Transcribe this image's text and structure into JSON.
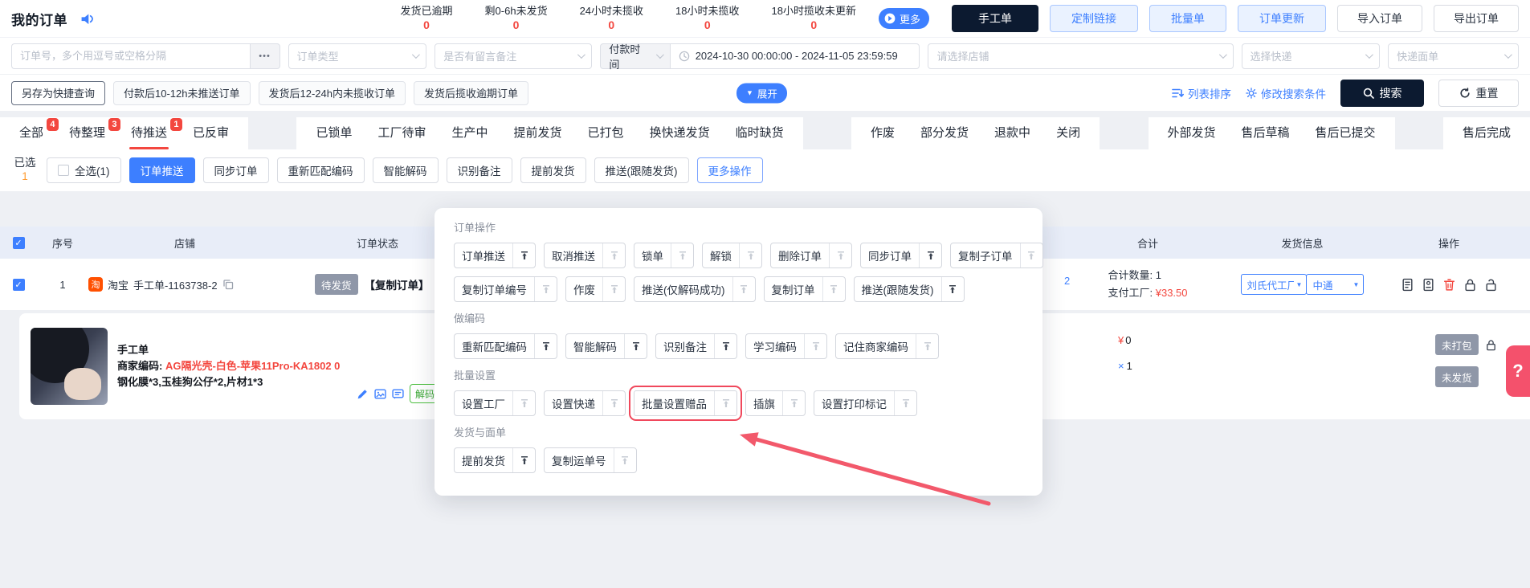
{
  "colors": {
    "primary": "#3d7fff",
    "danger": "#f3473f",
    "dark": "#0c1a30",
    "green": "#3aa834",
    "orange": "#ff9a2e"
  },
  "icons": {
    "check": "✓",
    "ellipsis": "•••",
    "caret_down": "▼",
    "select_caret": "▼",
    "question": "?"
  },
  "header": {
    "title": "我的订单",
    "stats": [
      {
        "label": "发货已逾期",
        "value": "0"
      },
      {
        "label": "剩0-6h未发货",
        "value": "0"
      },
      {
        "label": "24小时未揽收",
        "value": "0"
      },
      {
        "label": "18小时未揽收",
        "value": "0"
      },
      {
        "label": "18小时揽收未更新",
        "value": "0"
      }
    ],
    "more_label": "更多",
    "buttons": {
      "manual": "手工单",
      "custom_link": "定制链接",
      "batch": "批量单",
      "order_update": "订单更新",
      "import": "导入订单",
      "export": "导出订单"
    }
  },
  "filters": {
    "order_no_placeholder": "订单号，多个用逗号或空格分隔",
    "order_type": "订单类型",
    "has_message": "是否有留言备注",
    "pay_time": "付款时间",
    "date_range": "2024-10-30 00:00:00  -  2024-11-05 23:59:59",
    "shop": "请选择店铺",
    "express": "选择快递",
    "waybill": "快递面单"
  },
  "quick": {
    "save": "另存为快捷查询",
    "items": [
      "付款后10-12h未推送订单",
      "发货后12-24h内未揽收订单",
      "发货后揽收逾期订单"
    ],
    "expand": "展开",
    "sort": "列表排序",
    "modify": "修改搜索条件",
    "search": "搜索",
    "reset": "重置"
  },
  "tabs": {
    "group1": [
      {
        "label": "全部",
        "badge": "4"
      },
      {
        "label": "待整理",
        "badge": "3"
      },
      {
        "label": "待推送",
        "badge": "1",
        "active": true
      },
      {
        "label": "已反审"
      }
    ],
    "group2": [
      {
        "label": "已锁单"
      },
      {
        "label": "工厂待审"
      },
      {
        "label": "生产中"
      },
      {
        "label": "提前发货"
      },
      {
        "label": "已打包"
      },
      {
        "label": "换快递发货"
      },
      {
        "label": "临时缺货"
      }
    ],
    "group3": [
      {
        "label": "作废"
      },
      {
        "label": "部分发货"
      },
      {
        "label": "退款中"
      },
      {
        "label": "关闭"
      }
    ],
    "group4": [
      {
        "label": "外部发货"
      },
      {
        "label": "售后草稿"
      },
      {
        "label": "售后已提交"
      }
    ],
    "group5": [
      {
        "label": "售后完成"
      }
    ]
  },
  "action_bar": {
    "selected_label": "已选",
    "selected_count": "1",
    "select_all": "全选(1)",
    "push": "订单推送",
    "buttons": [
      "同步订单",
      "重新匹配编码",
      "智能解码",
      "识别备注",
      "提前发货",
      "推送(跟随发货)"
    ],
    "more": "更多操作"
  },
  "table": {
    "headers": [
      "序号",
      "店铺",
      "订单状态",
      "合计",
      "发货信息",
      "操作"
    ],
    "row": {
      "index": "1",
      "platform_glyph": "淘",
      "platform_name": "淘宝",
      "order_no": "手工单-1163738-2",
      "status": "待发货",
      "tag": "【复制订单】",
      "covered_fragment": "2",
      "qty_line": "合计数量: 1",
      "pay_label": "支付工厂:",
      "pay_value": "¥33.50",
      "factory": "刘氏代工厂",
      "express": "中通"
    },
    "product": {
      "name": "手工单",
      "code_label": "商家编码:",
      "code_value": "AG隔光壳-白色-苹果11Pro-KA1802 0",
      "spec": "钢化膜*3,玉桂狗公仔*2,片材1*3",
      "decode_badge": "解码成功",
      "currency": "¥",
      "price": "0",
      "times": "×",
      "qty": "1",
      "badge_pack": "未打包",
      "badge_ship": "未发货"
    }
  },
  "dropdown": {
    "s1": "订单操作",
    "s2": "做编码",
    "s3": "批量设置",
    "s4": "发货与面单",
    "rows1a": [
      {
        "label": "订单推送",
        "pinned": true
      },
      {
        "label": "取消推送"
      },
      {
        "label": "锁单"
      },
      {
        "label": "解锁"
      },
      {
        "label": "删除订单"
      },
      {
        "label": "同步订单",
        "pinned": true
      },
      {
        "label": "复制子订单"
      }
    ],
    "rows1b": [
      {
        "label": "复制订单编号"
      },
      {
        "label": "作废"
      },
      {
        "label": "推送(仅解码成功)"
      },
      {
        "label": "复制订单"
      },
      {
        "label": "推送(跟随发货)",
        "pinned": true
      }
    ],
    "rows2": [
      {
        "label": "重新匹配编码",
        "pinned": true
      },
      {
        "label": "智能解码",
        "pinned": true
      },
      {
        "label": "识别备注",
        "pinned": true
      },
      {
        "label": "学习编码"
      },
      {
        "label": "记住商家编码"
      }
    ],
    "rows3": [
      {
        "label": "设置工厂"
      },
      {
        "label": "设置快递"
      },
      {
        "label": "批量设置赠品",
        "highlight": true
      },
      {
        "label": "插旗"
      },
      {
        "label": "设置打印标记"
      }
    ],
    "rows4": [
      {
        "label": "提前发货",
        "pinned": true
      },
      {
        "label": "复制运单号"
      }
    ]
  }
}
